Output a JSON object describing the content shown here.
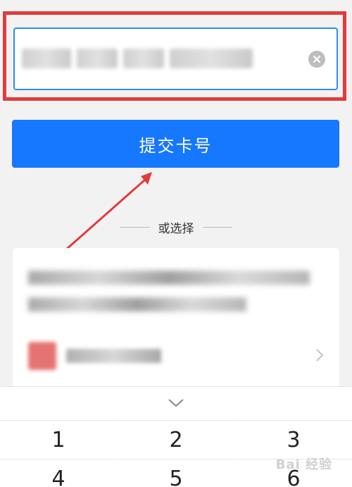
{
  "card_input": {
    "value": "•••• •••• •••• ••••"
  },
  "submit": {
    "label": "提交卡号"
  },
  "divider": {
    "label": "或选择"
  },
  "keyboard": {
    "keys": [
      "1",
      "2",
      "3",
      "4",
      "5",
      "6"
    ]
  },
  "colors": {
    "accent": "#1677ff",
    "highlight": "#e33b3b",
    "input_border": "#2f8cf3"
  },
  "watermark": "Bai 经验"
}
